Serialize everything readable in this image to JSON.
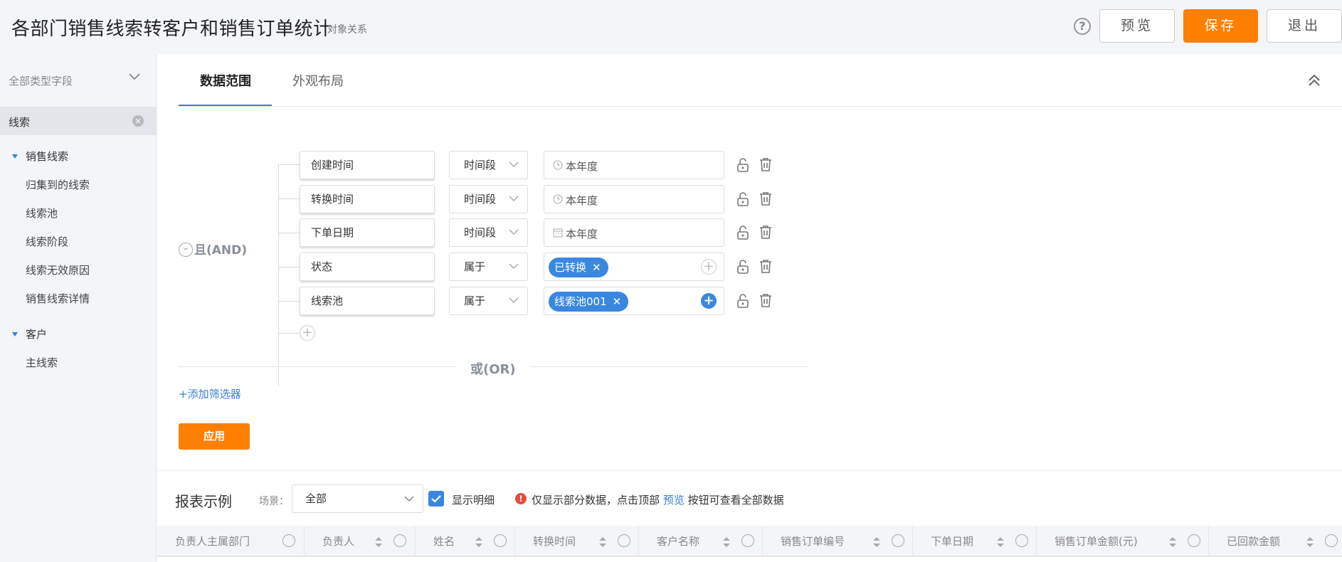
{
  "header": {
    "title": "各部门销售线索转客户和销售订单统计",
    "subtitle": "对象关系",
    "help": "?",
    "preview_label": "预览",
    "save_label": "保存",
    "exit_label": "退出"
  },
  "sidebar": {
    "type_select": "全部类型字段",
    "search_value": "线索",
    "groups": [
      {
        "label": "销售线索",
        "items": [
          "归集到的线索",
          "线索池",
          "线索阶段",
          "线索无效原因",
          "销售线索详情"
        ]
      },
      {
        "label": "客户",
        "items": [
          "主线索"
        ]
      }
    ]
  },
  "tabs": [
    {
      "label": "数据范围",
      "active": true
    },
    {
      "label": "外观布局",
      "active": false
    }
  ],
  "filter": {
    "and_label": "且(AND)",
    "or_label": "或(OR)",
    "add_filter": "+添加筛选器",
    "apply": "应用",
    "conditions": [
      {
        "field": "创建时间",
        "op": "时间段",
        "value": "本年度",
        "icon": "clock-icon"
      },
      {
        "field": "转换时间",
        "op": "时间段",
        "value": "本年度",
        "icon": "clock-icon"
      },
      {
        "field": "下单日期",
        "op": "时间段",
        "value": "本年度",
        "icon": "calendar-icon"
      },
      {
        "field": "状态",
        "op": "属于",
        "tag": "已转换"
      },
      {
        "field": "线索池",
        "op": "属于",
        "tag": "线索池001"
      }
    ]
  },
  "report": {
    "title": "报表示例",
    "scene_label": "场景：",
    "scene_value": "全部",
    "show_detail": "显示明细",
    "show_detail_checked": true,
    "warn_prefix": "仅显示部分数据，点击顶部 ",
    "warn_link": "预览",
    "warn_suffix": " 按钮可查看全部数据",
    "columns": [
      "负责人主属部门",
      "负责人",
      "姓名",
      "转换时间",
      "客户名称",
      "销售订单编号",
      "下单日期",
      "销售订单金额(元)",
      "已回款金额"
    ]
  },
  "colors": {
    "accent": "#3a87e0",
    "primary_button": "#ff7f00"
  }
}
